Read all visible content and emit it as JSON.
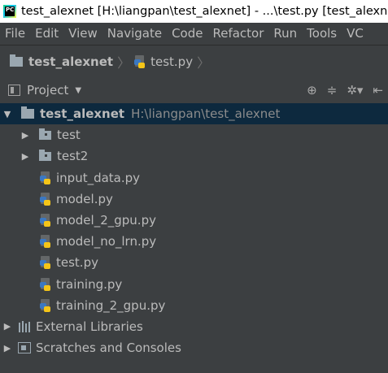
{
  "window": {
    "title": "test_alexnet [H:\\liangpan\\test_alexnet] - ...\\test.py [test_alexne",
    "logo_text": "PC"
  },
  "menu": [
    "File",
    "Edit",
    "View",
    "Navigate",
    "Code",
    "Refactor",
    "Run",
    "Tools",
    "VC"
  ],
  "breadcrumb": {
    "project": "test_alexnet",
    "file": "test.py"
  },
  "tool_window": {
    "title": "Project"
  },
  "tree": {
    "root": {
      "name": "test_alexnet",
      "path": "H:\\liangpan\\test_alexnet"
    },
    "folders": [
      "test",
      "test2"
    ],
    "files": [
      "input_data.py",
      "model.py",
      "model_2_gpu.py",
      "model_no_lrn.py",
      "test.py",
      "training.py",
      "training_2_gpu.py"
    ],
    "external_libraries": "External Libraries",
    "scratches": "Scratches and Consoles"
  },
  "colors": {
    "background": "#3c3f41",
    "selection": "#0d293e",
    "text": "#bbbbbb"
  },
  "icons": {
    "gear": "gear-icon",
    "locate": "locate-icon",
    "collapse": "collapse-icon",
    "hide": "hide-icon"
  }
}
